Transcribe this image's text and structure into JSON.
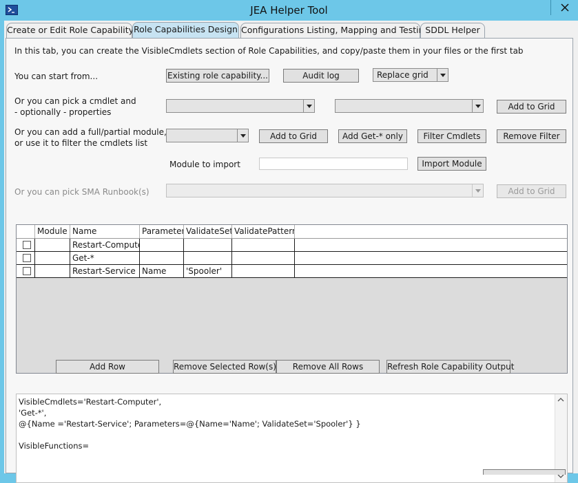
{
  "window": {
    "title": "JEA Helper Tool",
    "app_icon": "powershell-icon",
    "close_icon": "close-icon"
  },
  "tabs": [
    {
      "label": "Create or Edit Role Capability",
      "active": false
    },
    {
      "label": "Role Capabilities Design",
      "active": true
    },
    {
      "label": "Configurations Listing, Mapping and Testing",
      "active": false
    },
    {
      "label": "SDDL Helper",
      "active": false
    }
  ],
  "panel": {
    "intro": "In this tab, you can create the VisibleCmdlets section of Role Capabilities, and copy/paste them in your files or the first tab",
    "start_from": {
      "label": "You can start from...",
      "existing_button": "Existing role capability...",
      "audit_button": "Audit log",
      "mode_select": "Replace grid"
    },
    "pick_cmdlet": {
      "label_line1": "Or you can pick a cmdlet and",
      "label_line2": "- optionally - properties",
      "cmdlet_select": "",
      "property_select": "",
      "add_button": "Add to Grid"
    },
    "module": {
      "label_line1": "Or you can add a full/partial module,",
      "label_line2": "or use it to filter the cmdlets list",
      "module_select": "",
      "add_button": "Add to Grid",
      "add_get_button": "Add Get-* only",
      "filter_button": "Filter Cmdlets",
      "remove_filter_button": "Remove Filter"
    },
    "import": {
      "label": "Module to import",
      "value": "",
      "button": "Import Module"
    },
    "runbook": {
      "label": "Or you can pick SMA Runbook(s)",
      "select": "",
      "add_button": "Add to Grid"
    },
    "grid": {
      "columns": [
        "Module",
        "Name",
        "Parameter",
        "ValidateSet",
        "ValidatePattern"
      ],
      "rows": [
        {
          "checked": false,
          "module": "",
          "name": "Restart-Computer",
          "parameter": "",
          "validate_set": "",
          "validate_pattern": ""
        },
        {
          "checked": false,
          "module": "",
          "name": "Get-*",
          "parameter": "",
          "validate_set": "",
          "validate_pattern": ""
        },
        {
          "checked": false,
          "module": "",
          "name": "Restart-Service",
          "parameter": "Name",
          "validate_set": "'Spooler'",
          "validate_pattern": ""
        }
      ]
    },
    "grid_actions": {
      "add_row": "Add Row",
      "remove_selected": "Remove Selected Row(s)",
      "remove_all": "Remove All Rows",
      "refresh": "Refresh Role Capability Output"
    },
    "output": {
      "lines": [
        "VisibleCmdlets='Restart-Computer',",
        "'Get-*',",
        "@{Name ='Restart-Service'; Parameters=@{Name='Name'; ValidateSet='Spooler'} }",
        "",
        "VisibleFunctions="
      ]
    }
  }
}
